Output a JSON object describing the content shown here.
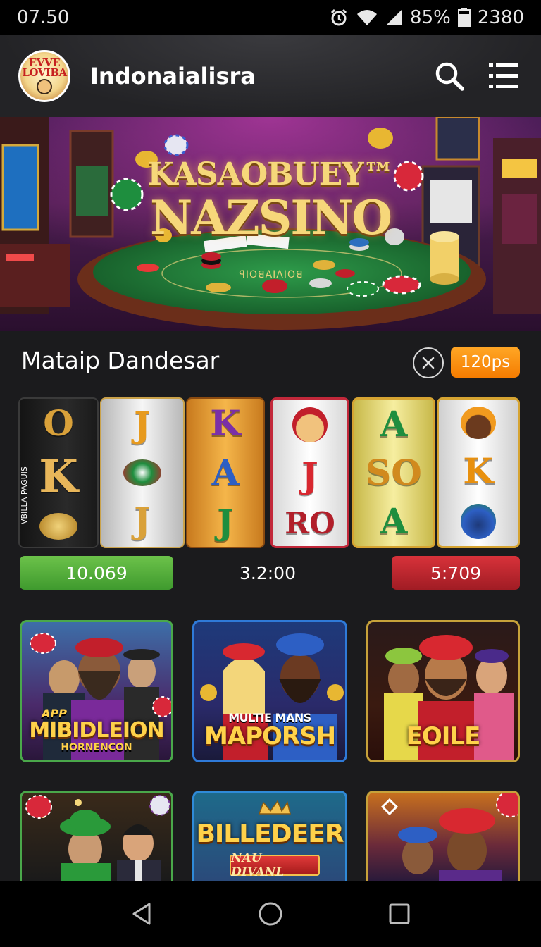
{
  "status_bar": {
    "time": "07.50",
    "battery": "85%",
    "extra": "2380"
  },
  "app_bar": {
    "logo_text": [
      "EVVE",
      "LOVIBA"
    ],
    "title": "Indonaialisra"
  },
  "hero": {
    "title_line1": "KASAOBUEY™",
    "title_line2": "NAZSINO",
    "table_text": "ꟼIOꓭAIΛIOꓭ"
  },
  "section": {
    "title": "Mataip Dandesar",
    "badge": "120ps"
  },
  "slots": {
    "side_text": "VBILLA PAGUIS",
    "reels": [
      {
        "symbols": [
          "O",
          "K",
          "chip"
        ]
      },
      {
        "symbols": [
          "J",
          "chip",
          "J"
        ]
      },
      {
        "symbols": [
          "K",
          "A",
          "J"
        ]
      },
      {
        "symbols": [
          "face",
          "J",
          "RO"
        ]
      },
      {
        "symbols": [
          "A",
          "SO",
          "A"
        ]
      },
      {
        "symbols": [
          "face",
          "K",
          "face"
        ]
      }
    ]
  },
  "values": {
    "left": "10.069",
    "middle": "3.2:00",
    "right": "5:709"
  },
  "games": [
    {
      "title": "MIBIDLEION",
      "pre": "APP",
      "subtitle": "HORNENCON"
    },
    {
      "title": "MAPORSH",
      "pre": "MULTIE MANS"
    },
    {
      "title": "EOILE"
    },
    {
      "title": ""
    },
    {
      "title": "BILLEDEER",
      "banner": "NAU DIVANL"
    },
    {
      "title": ""
    }
  ],
  "colors": {
    "accent_orange": "#f57c00",
    "positive_green": "#3f9a2e",
    "negative_red": "#a01c24"
  }
}
